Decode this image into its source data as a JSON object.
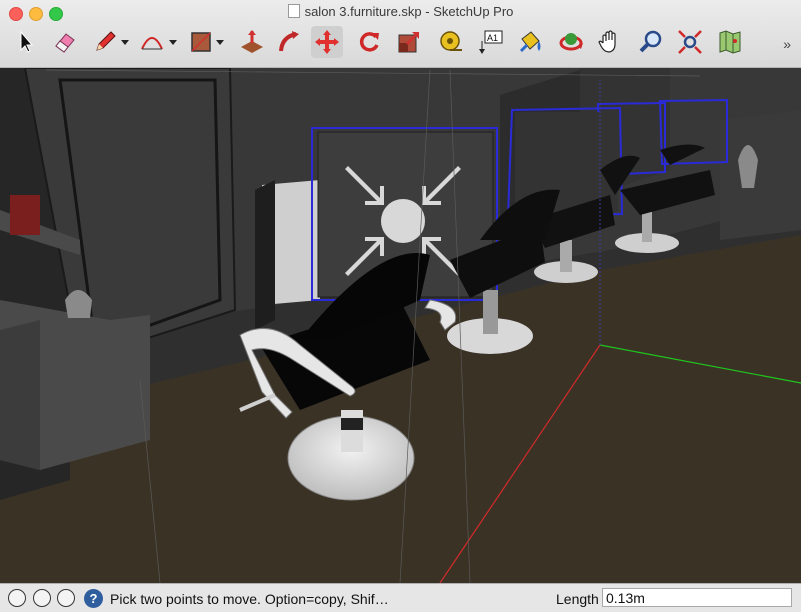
{
  "window": {
    "title": "salon 3.furniture.skp - SketchUp Pro"
  },
  "toolbar": {
    "tools": [
      {
        "name": "select-tool",
        "icon": "arrow-cursor-icon"
      },
      {
        "name": "eraser-tool",
        "icon": "eraser-icon"
      },
      {
        "name": "pencil-line-tool",
        "icon": "pencil-icon"
      },
      {
        "name": "arc-tool",
        "icon": "arc-icon"
      },
      {
        "name": "rectangle-tool",
        "icon": "rectangle-icon"
      },
      {
        "name": "push-pull-tool",
        "icon": "push-pull-icon"
      },
      {
        "name": "follow-me-tool",
        "icon": "follow-me-icon"
      },
      {
        "name": "move-tool",
        "icon": "move-arrows-icon",
        "active": true
      },
      {
        "name": "rotate-tool",
        "icon": "rotate-icon"
      },
      {
        "name": "scale-tool",
        "icon": "scale-icon"
      },
      {
        "name": "tape-measure-tool",
        "icon": "tape-measure-icon"
      },
      {
        "name": "text-tool",
        "icon": "text-a1-icon",
        "text": "A1"
      },
      {
        "name": "paint-bucket-tool",
        "icon": "paint-bucket-icon"
      },
      {
        "name": "orbit-tool",
        "icon": "orbit-icon"
      },
      {
        "name": "pan-tool",
        "icon": "hand-icon"
      },
      {
        "name": "zoom-tool",
        "icon": "magnifier-icon"
      },
      {
        "name": "zoom-extents-tool",
        "icon": "zoom-extents-icon"
      },
      {
        "name": "3d-warehouse-tool",
        "icon": "map-icon"
      }
    ],
    "overflow_label": "»"
  },
  "status": {
    "hint": "Pick two points to move.  Option=copy, Shif…",
    "help_label": "?",
    "length_label": "Length",
    "length_value": "0.13m"
  },
  "colors": {
    "selection": "#2a2ad8",
    "red_axis": "#d22a2a",
    "green_axis": "#1ec81e",
    "floor": "#3a3124"
  }
}
